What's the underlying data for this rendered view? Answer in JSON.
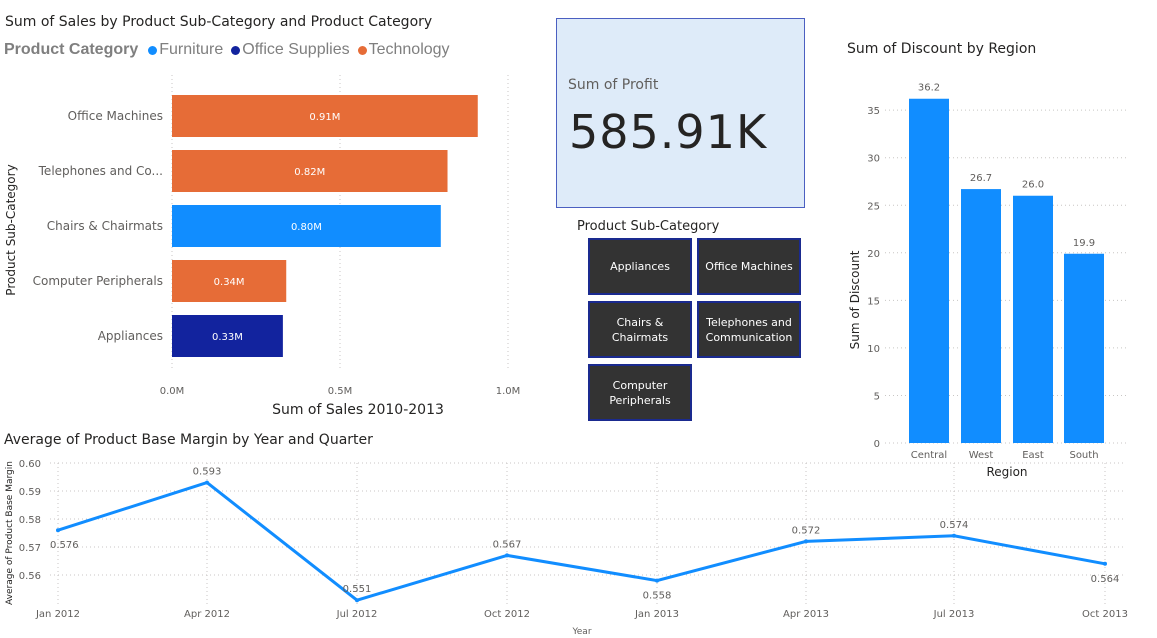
{
  "sales_chart": {
    "title": "Sum of Sales by Product Sub-Category and Product Category",
    "legend_title": "Product Category",
    "legend": [
      {
        "name": "Furniture",
        "color": "#118dff"
      },
      {
        "name": "Office Supplies",
        "color": "#12239e"
      },
      {
        "name": "Technology",
        "color": "#e66c37"
      }
    ]
  },
  "kpi": {
    "label": "Sum of Profit",
    "value": "585.91K"
  },
  "slicer": {
    "title": "Product Sub-Category",
    "items": [
      "Appliances",
      "Office Machines",
      "Chairs & Chairmats",
      "Telephones and Communication",
      "Computer Peripherals"
    ]
  },
  "discount_chart": {
    "title": "Sum of Discount by Region"
  },
  "margin_chart": {
    "title": "Average of Product Base Margin by Year and Quarter"
  },
  "chart_data": [
    {
      "type": "bar",
      "orientation": "horizontal",
      "title": "Sum of Sales by Product Sub-Category and Product Category",
      "xlabel": "Sum of Sales 2010-2013",
      "ylabel": "Product Sub-Category",
      "categories": [
        "Office Machines",
        "Telephones and Co...",
        "Chairs & Chairmats",
        "Computer Peripherals",
        "Appliances"
      ],
      "values": [
        0.91,
        0.82,
        0.8,
        0.34,
        0.33
      ],
      "value_labels": [
        "0.91M",
        "0.82M",
        "0.80M",
        "0.34M",
        "0.33M"
      ],
      "series_of_category": [
        "Technology",
        "Technology",
        "Furniture",
        "Technology",
        "Office Supplies"
      ],
      "units": "M",
      "xlim": [
        0,
        1.0
      ],
      "xticks": [
        0,
        0.5,
        1.0
      ],
      "xtick_labels": [
        "0.0M",
        "0.5M",
        "1.0M"
      ],
      "legend": {
        "title": "Product Category",
        "entries": [
          "Furniture",
          "Office Supplies",
          "Technology"
        ],
        "placement": "top-left"
      },
      "grid": true
    },
    {
      "type": "bar",
      "orientation": "vertical",
      "title": "Sum of Discount by Region",
      "xlabel": "Region",
      "ylabel": "Sum of Discount",
      "categories": [
        "Central",
        "West",
        "East",
        "South"
      ],
      "values": [
        36.2,
        26.7,
        26.0,
        19.9
      ],
      "value_labels": [
        "36.2",
        "26.7",
        "26.0",
        "19.9"
      ],
      "color": "#118dff",
      "ylim": [
        0,
        37
      ],
      "yticks": [
        0,
        5,
        10,
        15,
        20,
        25,
        30,
        35
      ],
      "grid": true
    },
    {
      "type": "line",
      "title": "Average of Product Base Margin by Year and Quarter",
      "xlabel": "Year",
      "ylabel": "Average of Product Base Margin",
      "x": [
        "Jan 2012",
        "Apr 2012",
        "Jul 2012",
        "Oct 2012",
        "Jan 2013",
        "Apr 2013",
        "Jul 2013",
        "Oct 2013"
      ],
      "values": [
        0.576,
        0.593,
        0.551,
        0.567,
        0.558,
        0.572,
        0.574,
        0.564
      ],
      "value_labels": [
        "0.576",
        "0.593",
        "0.551",
        "0.567",
        "0.558",
        "0.572",
        "0.574",
        "0.564"
      ],
      "label_positions": [
        "below",
        "above",
        "above",
        "above",
        "below",
        "above",
        "above",
        "below"
      ],
      "color": "#118dff",
      "ylim": [
        0.551,
        0.6
      ],
      "yticks": [
        0.56,
        0.57,
        0.58,
        0.59,
        0.6
      ],
      "ytick_labels": [
        "0.56",
        "0.57",
        "0.58",
        "0.59",
        "0.60"
      ],
      "grid": true
    }
  ]
}
